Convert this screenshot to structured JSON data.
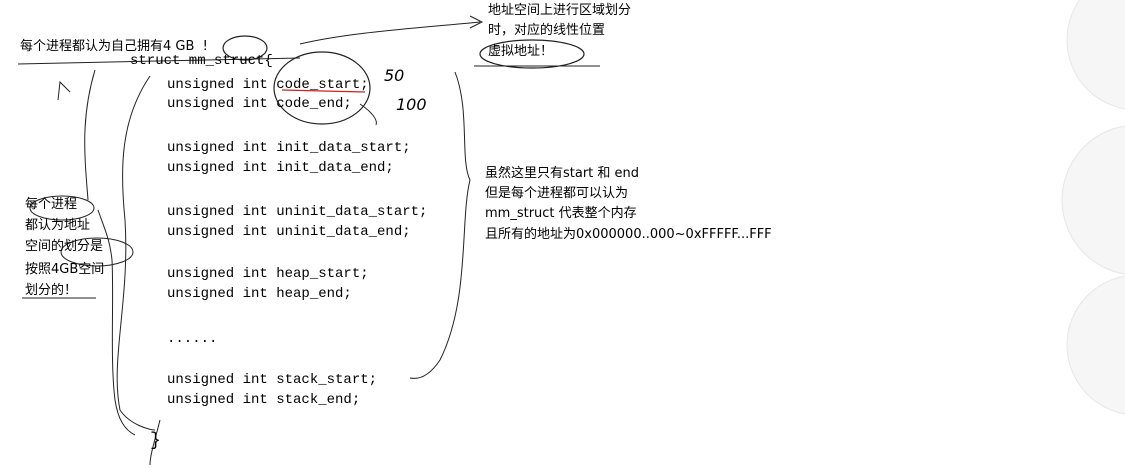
{
  "annotations": {
    "top_left": "每个进程都认为自己拥有4 GB  !",
    "top_right_lines": [
      "地址空间上进行区域划分",
      "时，对应的线性位置",
      "虚拟地址！"
    ],
    "left_lines": [
      "每个进程",
      "都认为地址",
      "空间的划分是",
      "按照4GB空间",
      "划分的！"
    ],
    "right_middle_lines": [
      "虽然这里只有start 和 end",
      "但是每个进程都可以认为",
      "mm_struct 代表整个内存",
      "且所有的地址为0x000000..000~0xFFFFF...FFF"
    ],
    "handwriting_marks": [
      "50",
      "100"
    ]
  },
  "code": {
    "header": "struct mm_struct{",
    "lines": [
      "unsigned int code_start;",
      "unsigned int code_end;",
      "unsigned int init_data_start;",
      "unsigned int init_data_end;",
      "unsigned int uninit_data_start;",
      "unsigned int uninit_data_end;",
      "unsigned int heap_start;",
      "unsigned int heap_end;",
      "......",
      "unsigned int stack_start;",
      "unsigned int stack_end;"
    ],
    "closing": "}"
  }
}
